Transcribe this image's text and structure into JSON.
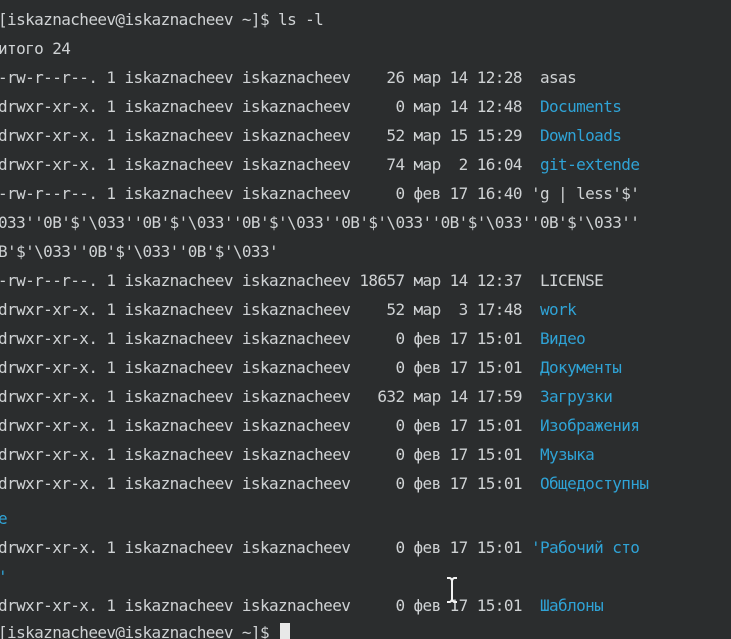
{
  "prompt_top": "[iskaznacheev@iskaznacheev ~]$ ",
  "command": "ls -l",
  "total": "итого 24",
  "entries": [
    {
      "prefix": "-rw-r--r--. 1 iskaznacheev iskaznacheev    26 мар 14 12:28  ",
      "name": "asas",
      "is_dir": false
    },
    {
      "prefix": "drwxr-xr-x. 1 iskaznacheev iskaznacheev     0 мар 14 12:48  ",
      "name": "Documents",
      "is_dir": true
    },
    {
      "prefix": "drwxr-xr-x. 1 iskaznacheev iskaznacheev    52 мар 15 15:29  ",
      "name": "Downloads",
      "is_dir": true
    },
    {
      "prefix": "drwxr-xr-x. 1 iskaznacheev iskaznacheev    74 мар  2 16:04  ",
      "name": "git-extende",
      "is_dir": true
    },
    {
      "prefix": "-rw-r--r--. 1 iskaznacheev iskaznacheev     0 фев 17 16:40 ",
      "name": "'g | less'$'",
      "is_dir": false
    }
  ],
  "wrap_lines": [
    "033''0B'$'\\033''0B'$'\\033''0B'$'\\033''0B'$'\\033''0B'$'\\033''0B'$'\\033''",
    "B'$'\\033''0B'$'\\033''0B'$'\\033'"
  ],
  "entries2": [
    {
      "prefix": "-rw-r--r--. 1 iskaznacheev iskaznacheev 18657 мар 14 12:37  ",
      "name": "LICENSE",
      "is_dir": false
    },
    {
      "prefix": "drwxr-xr-x. 1 iskaznacheev iskaznacheev    52 мар  3 17:48  ",
      "name": "work",
      "is_dir": true
    },
    {
      "prefix": "drwxr-xr-x. 1 iskaznacheev iskaznacheev     0 фев 17 15:01  ",
      "name": "Видео",
      "is_dir": true
    },
    {
      "prefix": "drwxr-xr-x. 1 iskaznacheev iskaznacheev     0 фев 17 15:01  ",
      "name": "Документы",
      "is_dir": true
    },
    {
      "prefix": "drwxr-xr-x. 1 iskaznacheev iskaznacheev   632 мар 14 17:59  ",
      "name": "Загрузки",
      "is_dir": true
    },
    {
      "prefix": "drwxr-xr-x. 1 iskaznacheev iskaznacheev     0 фев 17 15:01  ",
      "name": "Изображения",
      "is_dir": true
    },
    {
      "prefix": "drwxr-xr-x. 1 iskaznacheev iskaznacheev     0 фев 17 15:01  ",
      "name": "Музыка",
      "is_dir": true
    },
    {
      "prefix": "drwxr-xr-x. 1 iskaznacheev iskaznacheev     0 фев 17 15:01  ",
      "name": "Общедоступны",
      "is_dir": true
    }
  ],
  "wrap_e": "е",
  "entry_desktop": {
    "prefix": "drwxr-xr-x. 1 iskaznacheev iskaznacheev     0 фев 17 15:01 ",
    "name": "'Рабочий сто",
    "is_dir": true
  },
  "wrap_quote": "'",
  "entry_templates": {
    "prefix": "drwxr-xr-x. 1 iskaznacheev iskaznacheev     0 фев 17 15:01  ",
    "name": "Шаблоны",
    "is_dir": true
  },
  "prompt_bottom": "[iskaznacheev@iskaznacheev ~]$ ",
  "colors": {
    "background": "#2b2d2e",
    "text": "#cfd2d4",
    "directory": "#2fa3d6"
  }
}
